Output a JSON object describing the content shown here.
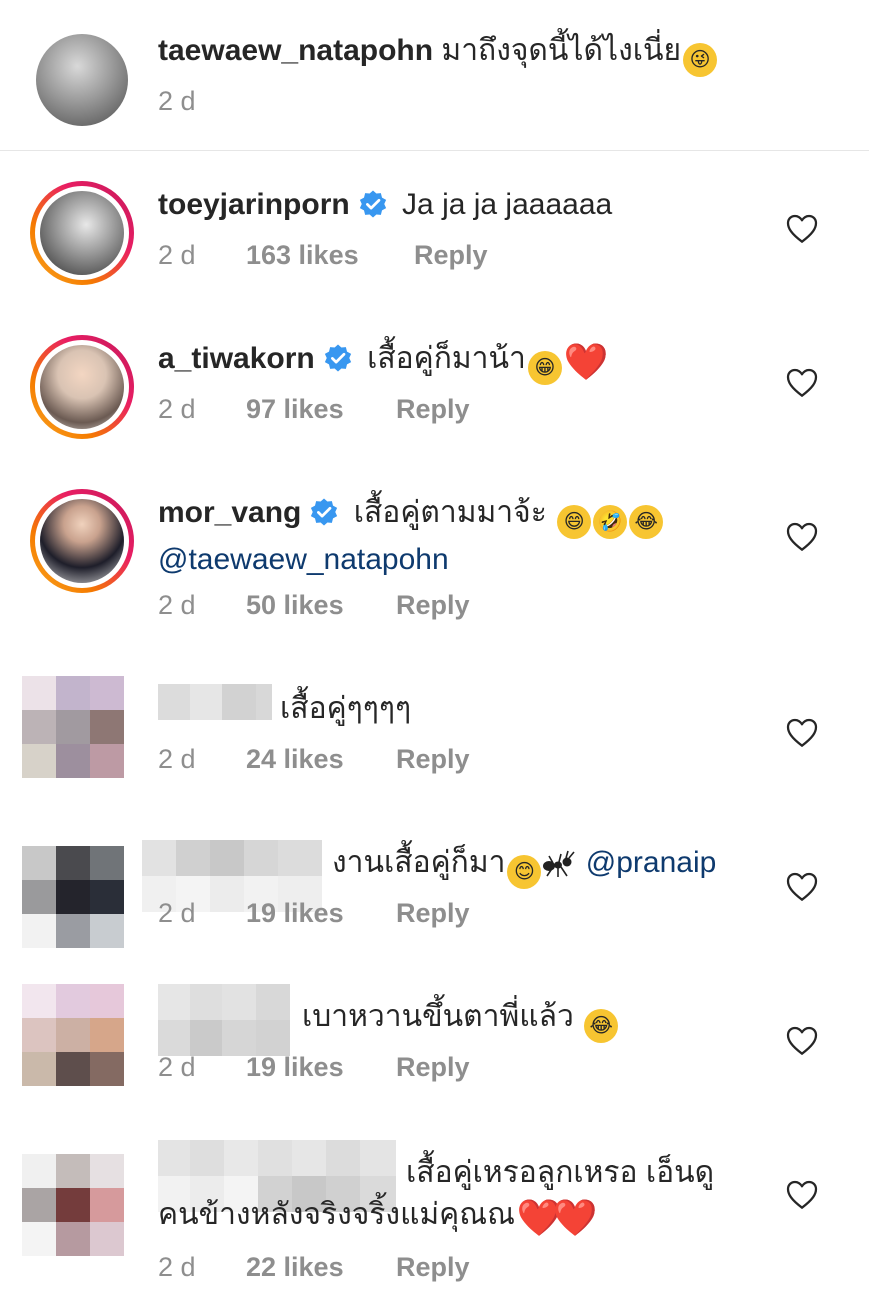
{
  "comments": [
    {
      "username": "taewaew_natapohn",
      "text": "มาถึงจุดนี้ได้ไงเนี่ย",
      "emoji": [
        "😜"
      ],
      "time": "2 d"
    },
    {
      "username": "toeyjarinporn",
      "text": "Ja ja ja jaaaaaa",
      "time": "2 d",
      "likes": "163 likes",
      "reply": "Reply"
    },
    {
      "username": "a_tiwakorn",
      "text": "เสื้อคู่ก็มาน้า",
      "emoji": [
        "😁",
        "❤️"
      ],
      "time": "2 d",
      "likes": "97 likes",
      "reply": "Reply"
    },
    {
      "username": "mor_vang",
      "text": "เสื้อคู่ตามมาจ้ะ",
      "emoji": [
        "😄",
        "🤣",
        "😂"
      ],
      "mention": "@taewaew_natapohn",
      "time": "2 d",
      "likes": "50 likes",
      "reply": "Reply"
    },
    {
      "text": "เสื้อคู่ๆๆๆๆ",
      "time": "2 d",
      "likes": "24 likes",
      "reply": "Reply"
    },
    {
      "text": "งานเสื้อคู่ก็มา",
      "emoji": [
        "😊",
        "🐜"
      ],
      "mention": "@pranaip",
      "time": "2 d",
      "likes": "19 likes",
      "reply": "Reply"
    },
    {
      "text": "เบาหวานขึ้นตาพี่แล้ว",
      "emoji": [
        "😂"
      ],
      "time": "2 d",
      "likes": "19 likes",
      "reply": "Reply"
    },
    {
      "text": "เสื้อคู่เหรอลูกเหรอ เอ็นดู",
      "text2": "คนข้างหลังจริงจริ้งแม่คุณณ",
      "emoji": [
        "❤️",
        "❤️"
      ],
      "time": "2 d",
      "likes": "22 likes",
      "reply": "Reply"
    }
  ],
  "icons": {
    "heart": "heart-outline-icon",
    "verified": "verified-badge-icon"
  },
  "colors": {
    "username": "#262626",
    "meta": "#8e8e8e",
    "mention": "#0e3a6e",
    "verified": "#3897f0",
    "story_ring_start": "#f9a825",
    "story_ring_end": "#c2185b"
  }
}
